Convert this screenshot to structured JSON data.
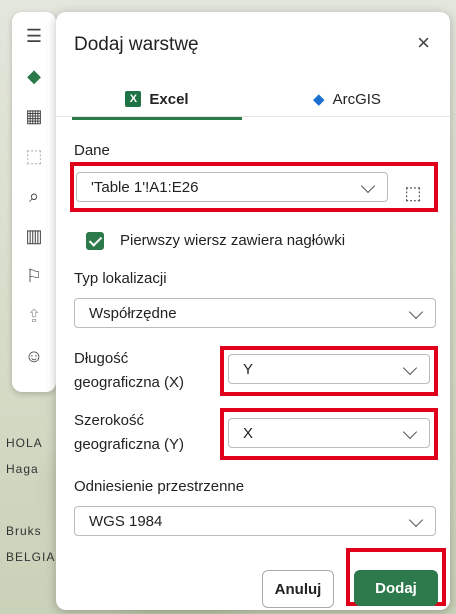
{
  "map": {
    "labels": [
      "HOLA",
      "Haga",
      "Bruks",
      "BELGIA"
    ]
  },
  "toolbar": {
    "icons": [
      "menu-icon",
      "layers-icon",
      "qr-code-icon",
      "select-area-icon",
      "search-icon",
      "chart-icon",
      "map-icon",
      "share-icon",
      "user-icon"
    ]
  },
  "panel": {
    "title": "Dodaj warstwę",
    "close_label": "×",
    "tabs": [
      {
        "label": "Excel",
        "icon": "excel-icon",
        "active": true
      },
      {
        "label": "ArcGIS",
        "icon": "layers-icon",
        "active": false
      }
    ],
    "data_label": "Dane",
    "data_value": "'Table 1'!A1:E26",
    "header_checkbox_label": "Pierwszy wiersz zawiera nagłówki",
    "header_checkbox_checked": true,
    "location_type_label": "Typ lokalizacji",
    "location_type_value": "Współrzędne",
    "longitude_label": [
      "Długość",
      "geograficzna (X)"
    ],
    "longitude_value": "Y",
    "latitude_label": [
      "Szerokość",
      "geograficzna (Y)"
    ],
    "latitude_value": "X",
    "spatial_ref_label": "Odniesienie przestrzenne",
    "spatial_ref_value": "WGS 1984",
    "cancel_label": "Anuluj",
    "add_label": "Dodaj",
    "accent_color": "#2c7a4b",
    "highlight_color": "#e0001a"
  }
}
